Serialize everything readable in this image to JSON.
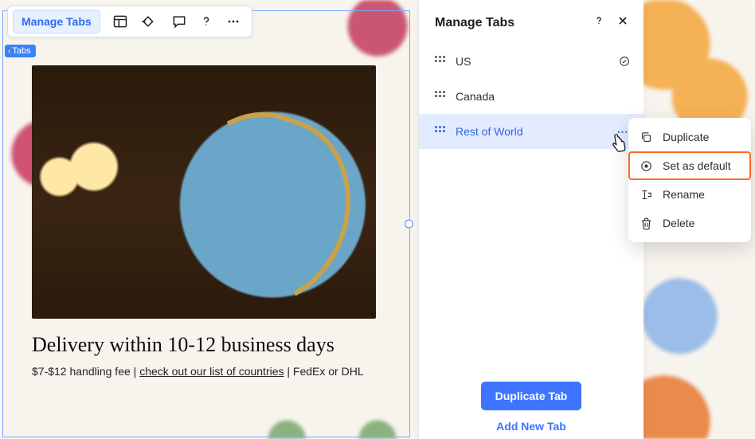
{
  "toolbar": {
    "manage_tabs_label": "Manage Tabs"
  },
  "element_tag": "Tabs",
  "content": {
    "heading": "Delivery within 10-12 business days",
    "fee_prefix": "$7-$12 handling fee | ",
    "countries_link": "check out our list of countries",
    "fee_suffix": " | FedEx or DHL"
  },
  "panel": {
    "title": "Manage Tabs",
    "tabs": [
      {
        "label": "US",
        "default": true
      },
      {
        "label": "Canada",
        "default": false
      },
      {
        "label": "Rest of World",
        "default": false
      }
    ],
    "duplicate_btn": "Duplicate Tab",
    "add_new_btn": "Add New Tab"
  },
  "menu": {
    "duplicate": "Duplicate",
    "set_default": "Set as default",
    "rename": "Rename",
    "delete": "Delete"
  }
}
